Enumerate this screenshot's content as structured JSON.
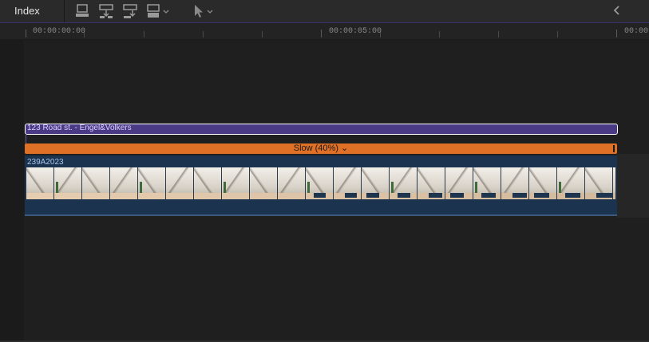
{
  "toolbar": {
    "index_label": "Index",
    "tools": [
      {
        "name": "connect-clip-icon"
      },
      {
        "name": "insert-clip-icon"
      },
      {
        "name": "append-clip-icon"
      },
      {
        "name": "overwrite-clip-icon"
      },
      {
        "name": "select-tool-icon"
      }
    ],
    "collapse_icon": "chevron-left-icon"
  },
  "ruler": {
    "timecodes": [
      "00:00:00:00",
      "00:00:05:00",
      "00:00"
    ]
  },
  "timeline": {
    "title_clip": {
      "label": "123 Road st. - Engel&Volkers",
      "color": "#4a3a86"
    },
    "retime": {
      "label": "Slow (40%) ⌄",
      "color": "#e07025"
    },
    "video_clip": {
      "label": "239A2023",
      "color": "#1c3350"
    }
  }
}
